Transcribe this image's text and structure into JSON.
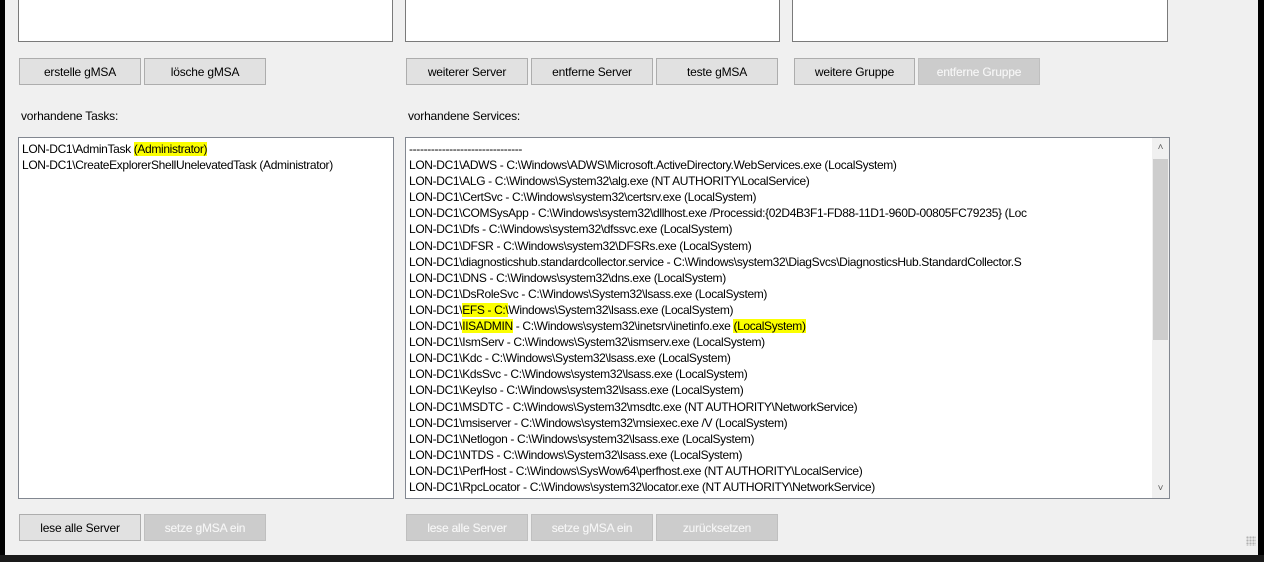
{
  "groups": [
    {
      "buttons": [
        {
          "label": "erstelle gMSA",
          "disabled": false
        },
        {
          "label": "lösche gMSA",
          "disabled": false
        }
      ],
      "list_label": "vorhandene Tasks:",
      "items": [
        {
          "pre": "LON-DC1\\AdminTask ",
          "hl": "(Administrator)",
          "post": ""
        },
        {
          "pre": "LON-DC1\\CreateExplorerShellUnelevatedTask (Administrator)",
          "hl": "",
          "post": ""
        }
      ],
      "bottom_buttons": [
        {
          "label": "lese alle Server",
          "disabled": false
        },
        {
          "label": "setze gMSA ein",
          "disabled": true
        }
      ]
    },
    {
      "buttons": [
        {
          "label": "weiterer Server",
          "disabled": false
        },
        {
          "label": "entferne Server",
          "disabled": false
        },
        {
          "label": "teste gMSA",
          "disabled": false
        }
      ],
      "list_label": "vorhandene Services:",
      "items": [
        {
          "pre": "-------------------------------",
          "hl": "",
          "post": ""
        },
        {
          "pre": "LON-DC1\\ADWS - C:\\Windows\\ADWS\\Microsoft.ActiveDirectory.WebServices.exe (LocalSystem)",
          "hl": "",
          "post": ""
        },
        {
          "pre": "LON-DC1\\ALG - C:\\Windows\\System32\\alg.exe (NT AUTHORITY\\LocalService)",
          "hl": "",
          "post": ""
        },
        {
          "pre": "LON-DC1\\CertSvc - C:\\Windows\\system32\\certsrv.exe (LocalSystem)",
          "hl": "",
          "post": ""
        },
        {
          "pre": "LON-DC1\\COMSysApp - C:\\Windows\\system32\\dllhost.exe /Processid:{02D4B3F1-FD88-11D1-960D-00805FC79235} (Loc",
          "hl": "",
          "post": ""
        },
        {
          "pre": "LON-DC1\\Dfs - C:\\Windows\\system32\\dfssvc.exe (LocalSystem)",
          "hl": "",
          "post": ""
        },
        {
          "pre": "LON-DC1\\DFSR - C:\\Windows\\system32\\DFSRs.exe (LocalSystem)",
          "hl": "",
          "post": ""
        },
        {
          "pre": "LON-DC1\\diagnosticshub.standardcollector.service - C:\\Windows\\system32\\DiagSvcs\\DiagnosticsHub.StandardCollector.S",
          "hl": "",
          "post": ""
        },
        {
          "pre": "LON-DC1\\DNS - C:\\Windows\\system32\\dns.exe (LocalSystem)",
          "hl": "",
          "post": ""
        },
        {
          "pre": "LON-DC1\\DsRoleSvc - C:\\Windows\\System32\\lsass.exe (LocalSystem)",
          "hl": "",
          "post": ""
        },
        {
          "pre": "LON-DC1\\",
          "hl": "EFS - C:\\",
          "post": "Windows\\System32\\lsass.exe (LocalSystem)"
        },
        {
          "pre": "LON-DC1\\",
          "hl": "IISADMIN",
          "post": " - C:\\Windows\\system32\\inetsrv\\inetinfo.exe ",
          "hl2": "(LocalSystem)"
        },
        {
          "pre": "LON-DC1\\IsmServ - C:\\Windows\\System32\\ismserv.exe (LocalSystem)",
          "hl": "",
          "post": ""
        },
        {
          "pre": "LON-DC1\\Kdc - C:\\Windows\\System32\\lsass.exe (LocalSystem)",
          "hl": "",
          "post": ""
        },
        {
          "pre": "LON-DC1\\KdsSvc - C:\\Windows\\system32\\lsass.exe (LocalSystem)",
          "hl": "",
          "post": ""
        },
        {
          "pre": "LON-DC1\\KeyIso - C:\\Windows\\system32\\lsass.exe (LocalSystem)",
          "hl": "",
          "post": ""
        },
        {
          "pre": "LON-DC1\\MSDTC - C:\\Windows\\System32\\msdtc.exe (NT AUTHORITY\\NetworkService)",
          "hl": "",
          "post": ""
        },
        {
          "pre": "LON-DC1\\msiserver - C:\\Windows\\system32\\msiexec.exe /V (LocalSystem)",
          "hl": "",
          "post": ""
        },
        {
          "pre": "LON-DC1\\Netlogon - C:\\Windows\\system32\\lsass.exe (LocalSystem)",
          "hl": "",
          "post": ""
        },
        {
          "pre": "LON-DC1\\NTDS - C:\\Windows\\System32\\lsass.exe (LocalSystem)",
          "hl": "",
          "post": ""
        },
        {
          "pre": "LON-DC1\\PerfHost - C:\\Windows\\SysWow64\\perfhost.exe (NT AUTHORITY\\LocalService)",
          "hl": "",
          "post": ""
        },
        {
          "pre": "LON-DC1\\RpcLocator - C:\\Windows\\system32\\locator.exe (NT AUTHORITY\\NetworkService)",
          "hl": "",
          "post": ""
        }
      ],
      "bottom_buttons": [
        {
          "label": "lese alle Server",
          "disabled": true
        },
        {
          "label": "setze gMSA ein",
          "disabled": true
        },
        {
          "label": "zurücksetzen",
          "disabled": true
        }
      ]
    },
    {
      "buttons": [
        {
          "label": "weitere Gruppe",
          "disabled": false
        },
        {
          "label": "entferne Gruppe",
          "disabled": true
        }
      ]
    }
  ],
  "scroll_icons": {
    "up": "scroll-up-arrow-icon",
    "down": "scroll-down-arrow-icon"
  },
  "highlight_color": "#fbff00"
}
